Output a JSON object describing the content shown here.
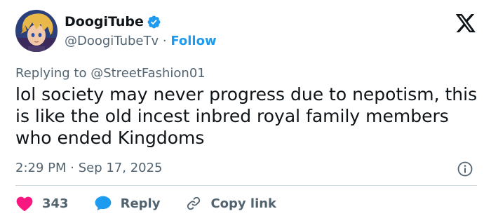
{
  "tweet": {
    "author": {
      "display_name": "DoogiTube",
      "handle": "@DoogiTubeTv",
      "separator": "·",
      "follow_label": "Follow",
      "verified": true
    },
    "replying_to_prefix": "Replying to ",
    "replying_to_handle": "@StreetFashion01",
    "text": "lol society may never progress due to nepotism, this is like the old incest inbred royal family members who ended Kingdoms",
    "timestamp": "2:29 PM · Sep 17, 2025",
    "actions": {
      "like_count": "343",
      "reply_label": "Reply",
      "copy_label": "Copy link"
    }
  },
  "colors": {
    "text": "#0f1419",
    "secondary": "#536471",
    "accent": "#1d9bf0",
    "like": "#f91880",
    "divider": "#cfd9de"
  },
  "icons": [
    "avatar-image",
    "verified-badge-icon",
    "x-logo-icon",
    "info-icon",
    "heart-icon",
    "reply-bubble-icon",
    "link-icon"
  ]
}
